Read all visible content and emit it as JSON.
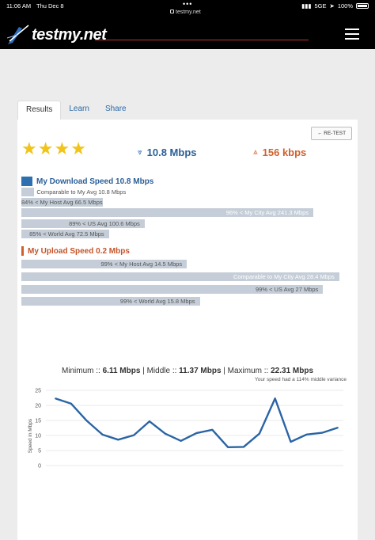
{
  "status": {
    "time": "11:06 AM",
    "date": "Thu Dec 8",
    "url": "testmy.net",
    "signal": "5GE",
    "battery": "100%"
  },
  "site": {
    "logo": "testmy.net"
  },
  "tabs": [
    "Results",
    "Learn",
    "Share"
  ],
  "retest_label": "← RE-TEST",
  "rating": {
    "stars": 4
  },
  "download": {
    "value": "10.8 Mbps"
  },
  "upload": {
    "value": "156 kbps"
  },
  "download_section": {
    "title": "My Download Speed 10.8 Mbps",
    "rows": [
      {
        "label": "Comparable to My Avg 10.8 Mbps",
        "fill": 0.04
      },
      {
        "label": "84% < My Host Avg 66.5 Mbps",
        "fill": 0.25
      },
      {
        "label": "96% < My City Avg 241.3 Mbps",
        "fill": 0.9
      },
      {
        "label": "89% < US Avg 100.6 Mbps",
        "fill": 0.38
      },
      {
        "label": "85% < World Avg 72.5 Mbps",
        "fill": 0.27
      }
    ]
  },
  "upload_section": {
    "title": "My Upload Speed 0.2 Mbps",
    "rows": [
      {
        "label": "99% < My Host Avg 14.5 Mbps",
        "fill": 0.51
      },
      {
        "label": "Comparable to My City Avg 28.4 Mbps",
        "fill": 0.98
      },
      {
        "label": "99% < US Avg 27 Mbps",
        "fill": 0.93
      },
      {
        "label": "99% < World Avg 15.8 Mbps",
        "fill": 0.55
      }
    ]
  },
  "chart_head": {
    "min_label": "Minimum :: ",
    "min_val": "6.11 Mbps",
    "mid_label": " | Middle :: ",
    "mid_val": "11.37 Mbps",
    "max_label": " | Maximum :: ",
    "max_val": "22.31 Mbps",
    "note": "Your speed had a 114% middle variance"
  },
  "chart_data": {
    "type": "line",
    "ylabel": "Speed in Mbps",
    "xlabel": "",
    "ylim": [
      0,
      25
    ],
    "yticks": [
      0,
      5,
      10,
      15,
      20,
      25
    ],
    "grid": true,
    "color": "#2a64a4",
    "series": [
      {
        "values": [
          22.3,
          20.6,
          14.9,
          10.3,
          8.6,
          10.1,
          14.7,
          10.6,
          8.2,
          10.8,
          11.9,
          6.1,
          6.2,
          10.6,
          22.3,
          7.9,
          10.3,
          10.9,
          12.6
        ]
      }
    ]
  }
}
